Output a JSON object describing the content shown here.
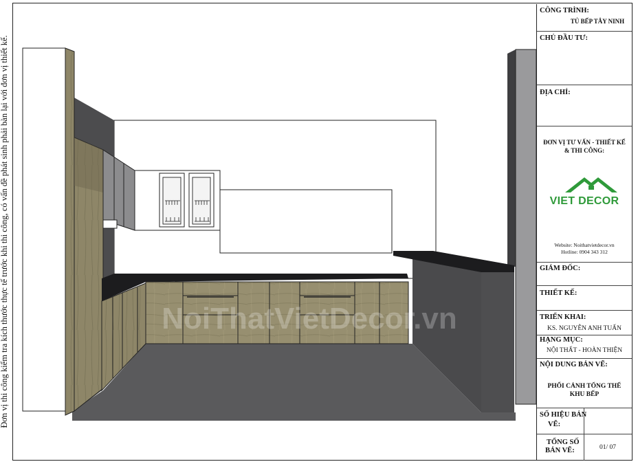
{
  "side_note": "Đơn vị thi công kiểm tra kích thước thực tế trước khi thi công, có vấn đề phát sinh phải bàn lại với đơn vị thiết kế.",
  "watermark": "NoiThatVietDecor.vn",
  "titleblock": {
    "cong_trinh_label": "CÔNG TRÌNH:",
    "cong_trinh_value": "TỦ BẾP TÂY NINH",
    "chu_dau_tu_label": "CHỦ ĐẦU TƯ:",
    "dia_chi_label": "ĐỊA CHỈ:",
    "don_vi_label_1": "ĐƠN VỊ TƯ VẤN - THIẾT KẾ",
    "don_vi_label_2": "& THI CÔNG:",
    "logo_text": "VIET DECOR",
    "website": "Website: Noithatvietdecor.vn",
    "hotline": "Hotline: 0904 343 312",
    "giam_doc_label": "GIÁM ĐỐC:",
    "thiet_ke_label": "THIẾT KẾ:",
    "trien_khai_label": "TRIỂN KHAI:",
    "trien_khai_value": "KS. NGUYỄN ANH TUẤN",
    "hang_muc_label": "HẠNG MỤC:",
    "hang_muc_value": "NỘI THẤT - HOÀN THIỆN",
    "noi_dung_label": "NỘI DUNG BẢN VẼ:",
    "noi_dung_value_1": "PHỐI CẢNH TỔNG THỂ",
    "noi_dung_value_2": "KHU BẾP",
    "so_hieu_label_1": "SỐ HIỆU BẢN",
    "so_hieu_label_2": "VẼ:",
    "tong_so_label_1": "TỔNG SỐ",
    "tong_so_label_2": "BẢN VẼ:",
    "tong_so_value": "01/ 07"
  },
  "colors": {
    "wood": "#8c8468",
    "wood_light": "#a39a7a",
    "dark_wall": "#4e4e50",
    "floor": "#5a5a5c",
    "countertop": "#1c1c1e",
    "grey_wall": "#9a9a9c",
    "logo_green": "#2f9a3a"
  }
}
